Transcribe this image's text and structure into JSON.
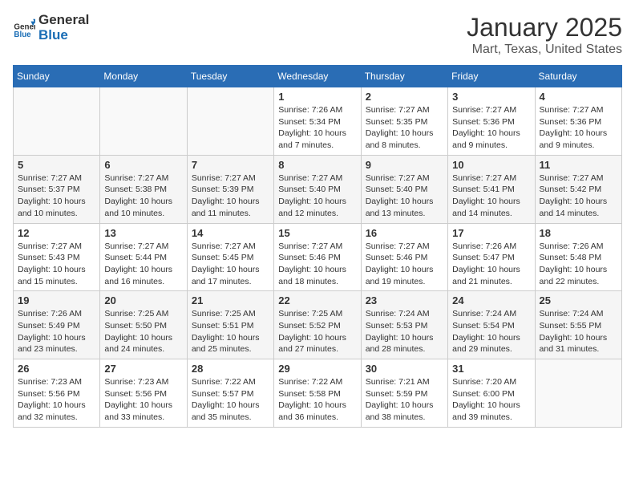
{
  "header": {
    "logo_line1": "General",
    "logo_line2": "Blue",
    "title": "January 2025",
    "subtitle": "Mart, Texas, United States"
  },
  "days_of_week": [
    "Sunday",
    "Monday",
    "Tuesday",
    "Wednesday",
    "Thursday",
    "Friday",
    "Saturday"
  ],
  "weeks": [
    [
      {
        "day": "",
        "content": ""
      },
      {
        "day": "",
        "content": ""
      },
      {
        "day": "",
        "content": ""
      },
      {
        "day": "1",
        "content": "Sunrise: 7:26 AM\nSunset: 5:34 PM\nDaylight: 10 hours\nand 7 minutes."
      },
      {
        "day": "2",
        "content": "Sunrise: 7:27 AM\nSunset: 5:35 PM\nDaylight: 10 hours\nand 8 minutes."
      },
      {
        "day": "3",
        "content": "Sunrise: 7:27 AM\nSunset: 5:36 PM\nDaylight: 10 hours\nand 9 minutes."
      },
      {
        "day": "4",
        "content": "Sunrise: 7:27 AM\nSunset: 5:36 PM\nDaylight: 10 hours\nand 9 minutes."
      }
    ],
    [
      {
        "day": "5",
        "content": "Sunrise: 7:27 AM\nSunset: 5:37 PM\nDaylight: 10 hours\nand 10 minutes."
      },
      {
        "day": "6",
        "content": "Sunrise: 7:27 AM\nSunset: 5:38 PM\nDaylight: 10 hours\nand 10 minutes."
      },
      {
        "day": "7",
        "content": "Sunrise: 7:27 AM\nSunset: 5:39 PM\nDaylight: 10 hours\nand 11 minutes."
      },
      {
        "day": "8",
        "content": "Sunrise: 7:27 AM\nSunset: 5:40 PM\nDaylight: 10 hours\nand 12 minutes."
      },
      {
        "day": "9",
        "content": "Sunrise: 7:27 AM\nSunset: 5:40 PM\nDaylight: 10 hours\nand 13 minutes."
      },
      {
        "day": "10",
        "content": "Sunrise: 7:27 AM\nSunset: 5:41 PM\nDaylight: 10 hours\nand 14 minutes."
      },
      {
        "day": "11",
        "content": "Sunrise: 7:27 AM\nSunset: 5:42 PM\nDaylight: 10 hours\nand 14 minutes."
      }
    ],
    [
      {
        "day": "12",
        "content": "Sunrise: 7:27 AM\nSunset: 5:43 PM\nDaylight: 10 hours\nand 15 minutes."
      },
      {
        "day": "13",
        "content": "Sunrise: 7:27 AM\nSunset: 5:44 PM\nDaylight: 10 hours\nand 16 minutes."
      },
      {
        "day": "14",
        "content": "Sunrise: 7:27 AM\nSunset: 5:45 PM\nDaylight: 10 hours\nand 17 minutes."
      },
      {
        "day": "15",
        "content": "Sunrise: 7:27 AM\nSunset: 5:46 PM\nDaylight: 10 hours\nand 18 minutes."
      },
      {
        "day": "16",
        "content": "Sunrise: 7:27 AM\nSunset: 5:46 PM\nDaylight: 10 hours\nand 19 minutes."
      },
      {
        "day": "17",
        "content": "Sunrise: 7:26 AM\nSunset: 5:47 PM\nDaylight: 10 hours\nand 21 minutes."
      },
      {
        "day": "18",
        "content": "Sunrise: 7:26 AM\nSunset: 5:48 PM\nDaylight: 10 hours\nand 22 minutes."
      }
    ],
    [
      {
        "day": "19",
        "content": "Sunrise: 7:26 AM\nSunset: 5:49 PM\nDaylight: 10 hours\nand 23 minutes."
      },
      {
        "day": "20",
        "content": "Sunrise: 7:25 AM\nSunset: 5:50 PM\nDaylight: 10 hours\nand 24 minutes."
      },
      {
        "day": "21",
        "content": "Sunrise: 7:25 AM\nSunset: 5:51 PM\nDaylight: 10 hours\nand 25 minutes."
      },
      {
        "day": "22",
        "content": "Sunrise: 7:25 AM\nSunset: 5:52 PM\nDaylight: 10 hours\nand 27 minutes."
      },
      {
        "day": "23",
        "content": "Sunrise: 7:24 AM\nSunset: 5:53 PM\nDaylight: 10 hours\nand 28 minutes."
      },
      {
        "day": "24",
        "content": "Sunrise: 7:24 AM\nSunset: 5:54 PM\nDaylight: 10 hours\nand 29 minutes."
      },
      {
        "day": "25",
        "content": "Sunrise: 7:24 AM\nSunset: 5:55 PM\nDaylight: 10 hours\nand 31 minutes."
      }
    ],
    [
      {
        "day": "26",
        "content": "Sunrise: 7:23 AM\nSunset: 5:56 PM\nDaylight: 10 hours\nand 32 minutes."
      },
      {
        "day": "27",
        "content": "Sunrise: 7:23 AM\nSunset: 5:56 PM\nDaylight: 10 hours\nand 33 minutes."
      },
      {
        "day": "28",
        "content": "Sunrise: 7:22 AM\nSunset: 5:57 PM\nDaylight: 10 hours\nand 35 minutes."
      },
      {
        "day": "29",
        "content": "Sunrise: 7:22 AM\nSunset: 5:58 PM\nDaylight: 10 hours\nand 36 minutes."
      },
      {
        "day": "30",
        "content": "Sunrise: 7:21 AM\nSunset: 5:59 PM\nDaylight: 10 hours\nand 38 minutes."
      },
      {
        "day": "31",
        "content": "Sunrise: 7:20 AM\nSunset: 6:00 PM\nDaylight: 10 hours\nand 39 minutes."
      },
      {
        "day": "",
        "content": ""
      }
    ]
  ]
}
